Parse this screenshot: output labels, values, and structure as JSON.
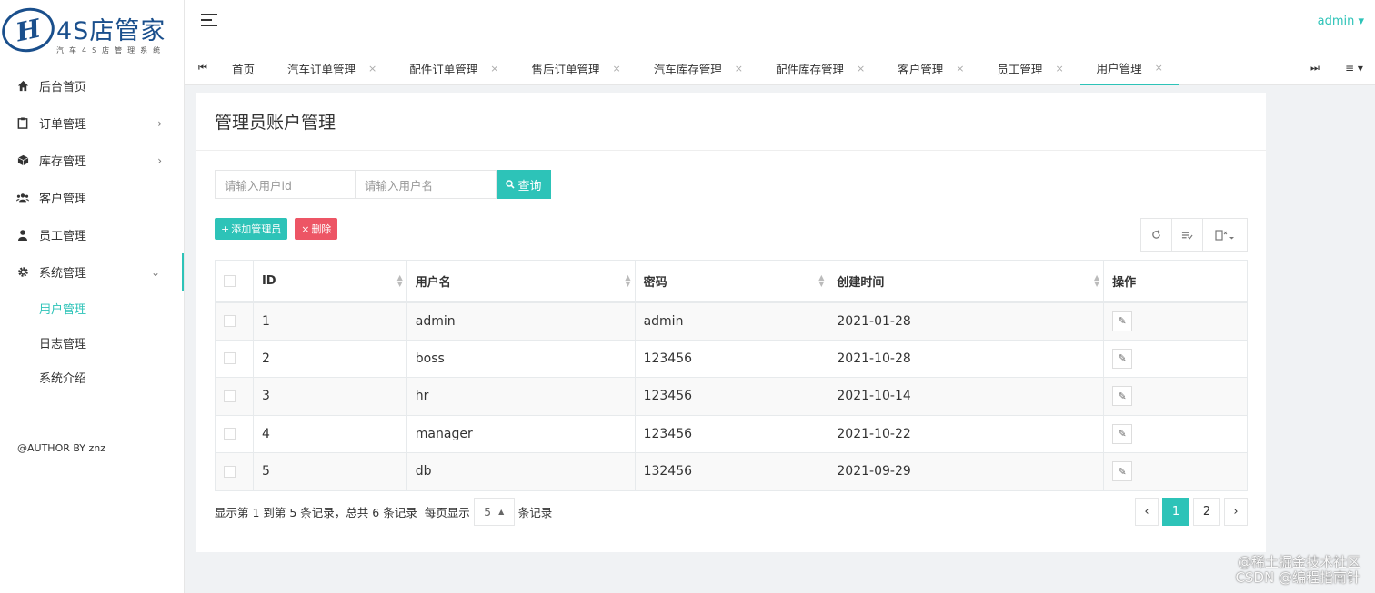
{
  "app": {
    "logo_mark": "H",
    "title": "4S店管家",
    "subtitle": "汽车4S店管理系统"
  },
  "sidebar": {
    "items": [
      {
        "label": "后台首页",
        "icon": "home-icon"
      },
      {
        "label": "订单管理",
        "icon": "clipboard-icon",
        "arrow": "›"
      },
      {
        "label": "库存管理",
        "icon": "cube-icon",
        "arrow": "›"
      },
      {
        "label": "客户管理",
        "icon": "users-icon"
      },
      {
        "label": "员工管理",
        "icon": "user-icon"
      },
      {
        "label": "系统管理",
        "icon": "gear-icon",
        "arrow": "⌄"
      }
    ],
    "submenu": [
      "用户管理",
      "日志管理",
      "系统介绍"
    ],
    "author": "@AUTHOR BY znz"
  },
  "header": {
    "user": "admin ▾"
  },
  "tabs": {
    "prev": "⏮",
    "next": "⏭",
    "menu": "≡ ▾",
    "items": [
      "首页",
      "汽车订单管理",
      "配件订单管理",
      "售后订单管理",
      "汽车库存管理",
      "配件库存管理",
      "客户管理",
      "员工管理",
      "用户管理"
    ],
    "close": "×"
  },
  "main": {
    "title": "管理员账户管理",
    "search": {
      "id_placeholder": "请输入用户id",
      "name_placeholder": "请输入用户名",
      "button": "查询"
    },
    "add_button": "添加管理员",
    "delete_button": "删除",
    "table": {
      "columns": [
        "ID",
        "用户名",
        "密码",
        "创建时间",
        "操作"
      ],
      "rows": [
        [
          "1",
          "admin",
          "admin",
          "2021-01-28"
        ],
        [
          "2",
          "boss",
          "123456",
          "2021-10-28"
        ],
        [
          "3",
          "hr",
          "123456",
          "2021-10-14"
        ],
        [
          "4",
          "manager",
          "123456",
          "2021-10-22"
        ],
        [
          "5",
          "db",
          "132456",
          "2021-09-29"
        ]
      ]
    },
    "pagination": {
      "info": "显示第 1 到第 5 条记录，总共 6 条记录",
      "per_page_prefix": "每页显示",
      "page_size": "5",
      "per_page_suffix": "条记录",
      "pages": [
        "1",
        "2"
      ],
      "current": "1"
    }
  },
  "watermark": {
    "line1": "@稀土掘金技术社区",
    "line2": "CSDN @编程指南针"
  },
  "colors": {
    "accent": "#2dc3b8",
    "danger": "#ed5565",
    "brand": "#1a4f8c"
  }
}
